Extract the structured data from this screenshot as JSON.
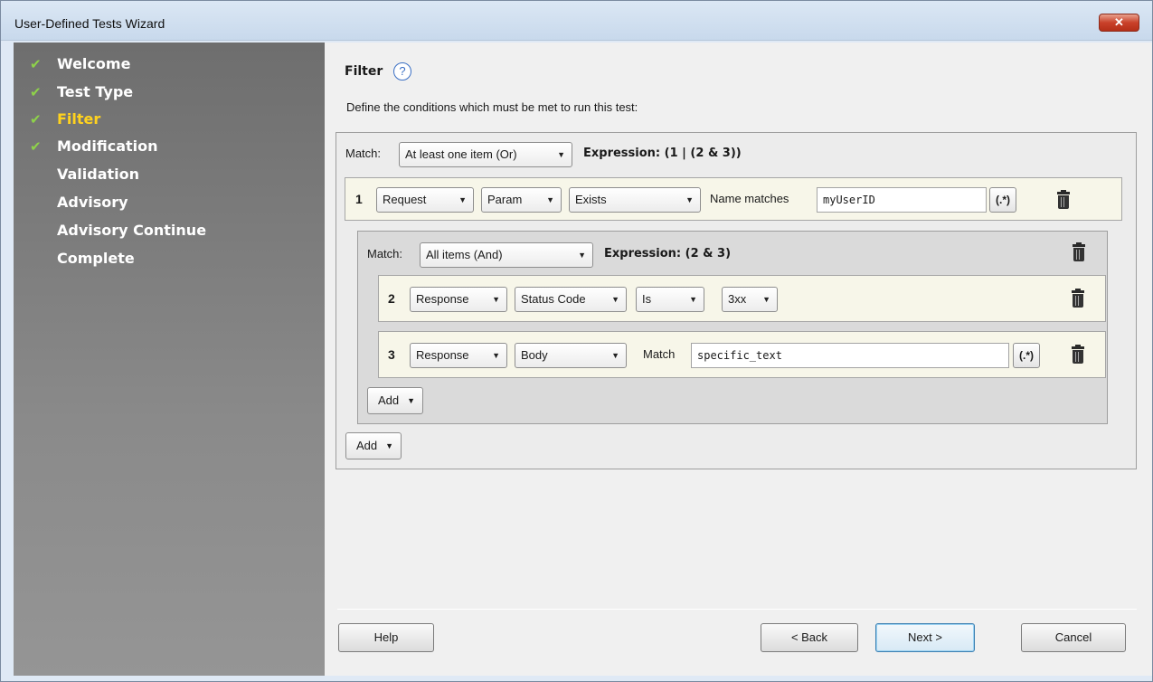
{
  "window": {
    "title": "User-Defined Tests Wizard",
    "close_label": "✕"
  },
  "steps": [
    {
      "label": "Welcome",
      "done": true
    },
    {
      "label": "Test Type",
      "done": true
    },
    {
      "label": "Filter",
      "done": true,
      "active": true
    },
    {
      "label": "Modification",
      "done": true
    },
    {
      "label": "Validation",
      "done": false
    },
    {
      "label": "Advisory",
      "done": false
    },
    {
      "label": "Advisory Continue",
      "done": false
    },
    {
      "label": "Complete",
      "done": false
    }
  ],
  "page": {
    "heading": "Filter",
    "help_icon": "?",
    "instructions": "Define the conditions which must be met to run this test:"
  },
  "outer": {
    "match_label": "Match:",
    "match_value": "At least one item (Or)",
    "expression": "Expression: (1 | (2 & 3))",
    "row1": {
      "num": "1",
      "source": "Request",
      "target": "Param",
      "operator": "Exists",
      "name_label": "Name matches",
      "name_value": "myUserID",
      "regex_label": "(.*)"
    },
    "add_label": "Add"
  },
  "inner": {
    "match_label": "Match:",
    "match_value": "All items (And)",
    "expression": "Expression: (2 & 3)",
    "row2": {
      "num": "2",
      "source": "Response",
      "target": "Status Code",
      "operator": "Is",
      "value": "3xx"
    },
    "row3": {
      "num": "3",
      "source": "Response",
      "target": "Body",
      "match_label": "Match",
      "match_value": "specific_text",
      "regex_label": "(.*)"
    },
    "add_label": "Add"
  },
  "footer": {
    "help": "Help",
    "back": "< Back",
    "next": "Next >",
    "cancel": "Cancel"
  },
  "colors": {
    "active_step": "#ffd21e",
    "check": "#8ed24a",
    "row_bg": "#f7f6e9"
  }
}
